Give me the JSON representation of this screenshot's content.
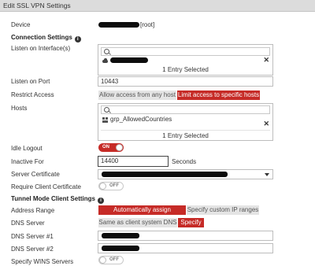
{
  "window": {
    "title": "Edit SSL VPN Settings"
  },
  "device": {
    "label": "Device",
    "suffix": "[root]"
  },
  "connection": {
    "heading": "Connection Settings",
    "listen_interfaces": {
      "label": "Listen on Interface(s)",
      "selected_count": "1 Entry Selected"
    },
    "listen_port": {
      "label": "Listen on Port",
      "value": "10443"
    },
    "restrict_access": {
      "label": "Restrict Access",
      "option_any": "Allow access from any host",
      "option_specific": "Limit access to specific hosts",
      "selected": "option_specific"
    },
    "hosts": {
      "label": "Hosts",
      "entry": "grp_AllowedCountries",
      "selected_count": "1 Entry Selected"
    },
    "idle_logout": {
      "label": "Idle Logout",
      "state": "ON"
    },
    "inactive_for": {
      "label": "Inactive For",
      "value": "14400",
      "unit": "Seconds"
    },
    "server_certificate": {
      "label": "Server Certificate"
    },
    "require_client_cert": {
      "label": "Require Client Certificate",
      "state": "OFF"
    }
  },
  "tunnel": {
    "heading": "Tunnel Mode Client Settings",
    "address_range": {
      "label": "Address Range",
      "option_auto": "Automatically assign addresses",
      "option_custom": "Specify custom IP ranges",
      "selected": "option_auto"
    },
    "dns_server": {
      "label": "DNS Server",
      "option_same": "Same as client system DNS",
      "option_specify": "Specify",
      "selected": "option_specify"
    },
    "dns1": {
      "label": "DNS Server #1"
    },
    "dns2": {
      "label": "DNS Server #2"
    },
    "wins": {
      "label": "Specify WINS Servers",
      "state": "OFF"
    }
  },
  "colors": {
    "accent": "#c62b27",
    "title_bar": "#dcdcdc"
  }
}
